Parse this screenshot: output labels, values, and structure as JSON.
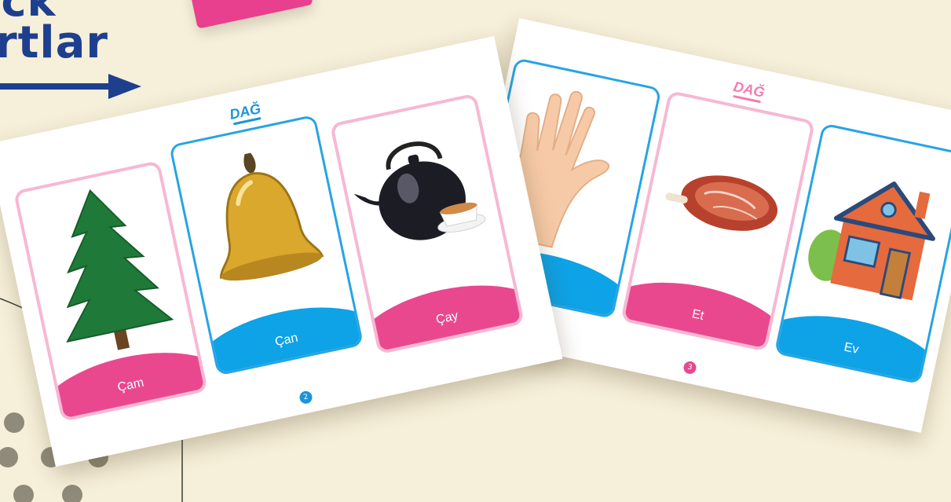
{
  "header": {
    "title_line1": "ıck",
    "title_line2": "rtlar"
  },
  "sheets": [
    {
      "brand": "DAĞ",
      "page_number": "2",
      "cards": [
        {
          "label": "Çam",
          "icon": "pine-tree-icon",
          "color": "pink"
        },
        {
          "label": "Çan",
          "icon": "bell-icon",
          "color": "blue"
        },
        {
          "label": "Çay",
          "icon": "teapot-icon",
          "color": "pink"
        }
      ]
    },
    {
      "brand": "DAĞ",
      "page_number": "3",
      "cards": [
        {
          "label": "",
          "icon": "hand-icon",
          "color": "blue"
        },
        {
          "label": "Et",
          "icon": "meat-icon",
          "color": "pink"
        },
        {
          "label": "Ev",
          "icon": "house-icon",
          "color": "blue"
        }
      ]
    }
  ],
  "colors": {
    "background": "#f6efd9",
    "title": "#1d3f8e",
    "pink": "#e9488f",
    "blue": "#0ea2e6"
  }
}
